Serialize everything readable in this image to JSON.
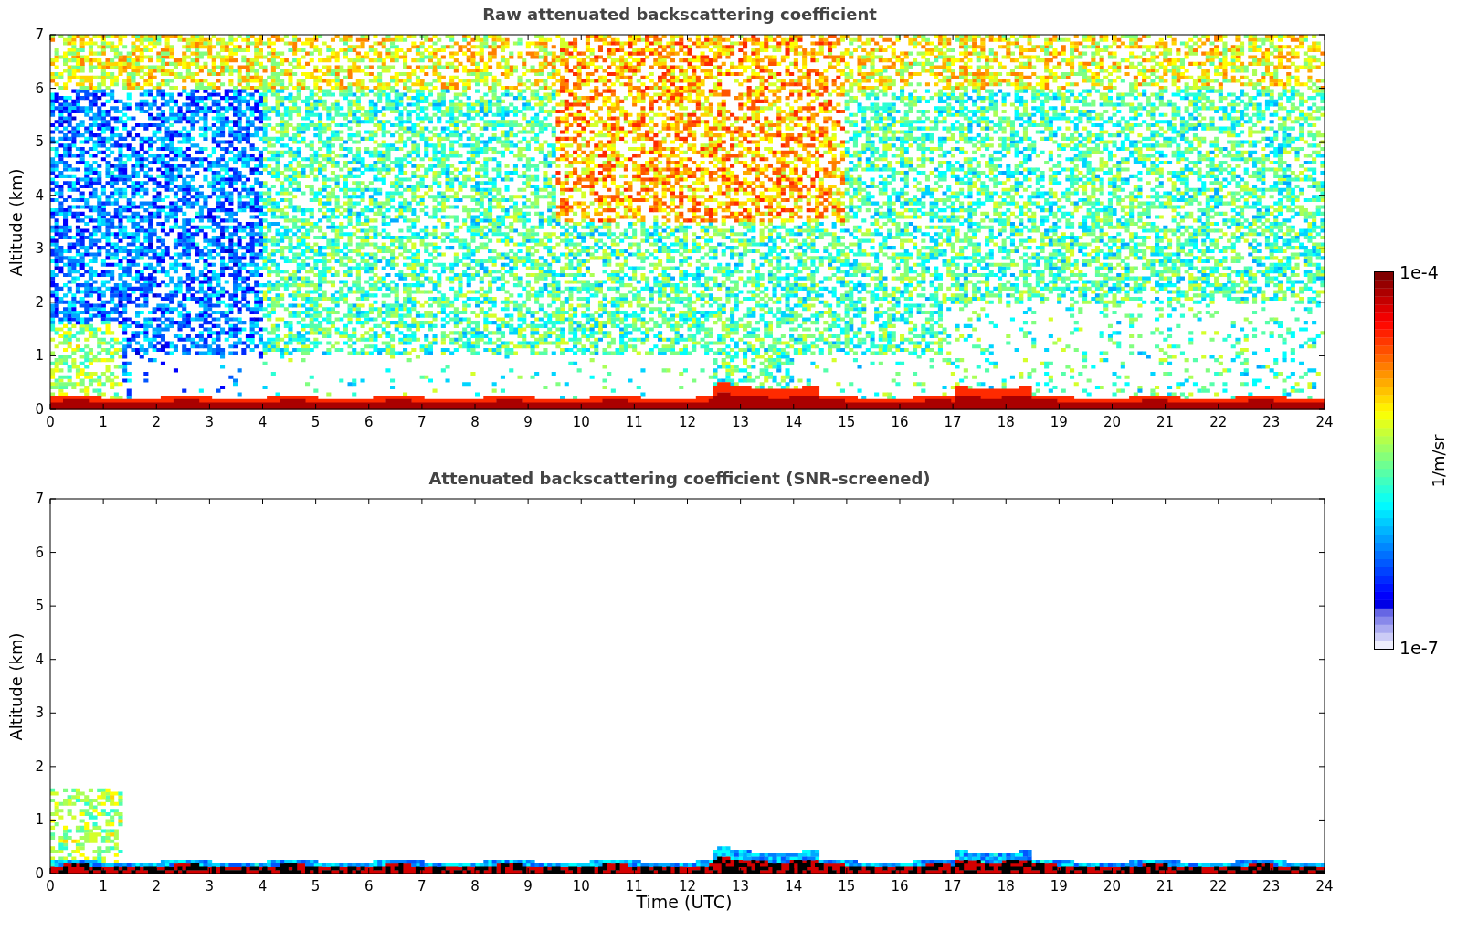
{
  "panels": [
    {
      "kind": "raw",
      "title": "Raw attenuated backscattering coefficient",
      "ylabel": "Altitude (km)",
      "yticks": [
        "7",
        "6",
        "5",
        "4",
        "3",
        "2",
        "1",
        "0"
      ],
      "xticks": [
        "0",
        "1",
        "2",
        "3",
        "4",
        "5",
        "6",
        "7",
        "8",
        "9",
        "10",
        "11",
        "12",
        "13",
        "14",
        "15",
        "16",
        "17",
        "18",
        "19",
        "20",
        "21",
        "22",
        "23",
        "24"
      ]
    },
    {
      "kind": "screened",
      "title": "Attenuated backscattering coefficient (SNR-screened)",
      "ylabel": "Altitude (km)",
      "yticks": [
        "7",
        "6",
        "5",
        "4",
        "3",
        "2",
        "1",
        "0"
      ],
      "xticks": [
        "0",
        "1",
        "2",
        "3",
        "4",
        "5",
        "6",
        "7",
        "8",
        "9",
        "10",
        "11",
        "12",
        "13",
        "14",
        "15",
        "16",
        "17",
        "18",
        "19",
        "20",
        "21",
        "22",
        "23",
        "24"
      ],
      "xlabel": "Time (UTC)"
    }
  ],
  "colorbar": {
    "max": "1e-4",
    "min": "1e-7",
    "label": "1/m/sr"
  }
}
